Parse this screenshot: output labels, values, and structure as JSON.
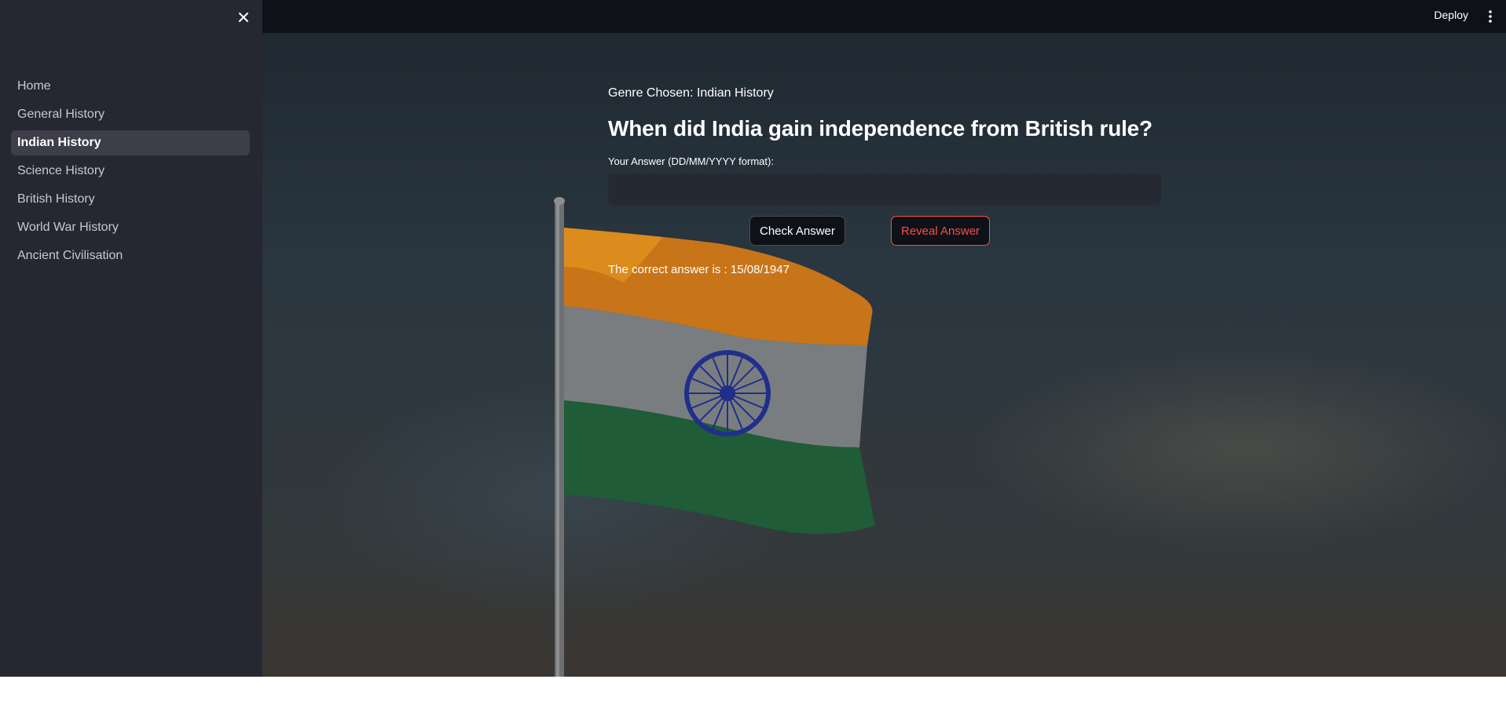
{
  "sidebar": {
    "items": [
      {
        "label": "Home"
      },
      {
        "label": "General History"
      },
      {
        "label": "Indian History"
      },
      {
        "label": "Science History"
      },
      {
        "label": "British History"
      },
      {
        "label": "World War History"
      },
      {
        "label": "Ancient Civilisation"
      }
    ],
    "active_index": 2
  },
  "header": {
    "deploy_label": "Deploy"
  },
  "main": {
    "genre_text": "Genre Chosen: Indian History",
    "question": "When did India gain independence from British rule?",
    "answer_label": "Your Answer (DD/MM/YYYY format):",
    "answer_value": "",
    "check_button": "Check Answer",
    "reveal_button": "Reveal Answer",
    "result_text": "The correct answer is : 15/08/1947"
  },
  "colors": {
    "sidebar_bg": "#262730",
    "header_bg": "#0e1117",
    "accent_red": "#ff4b4b",
    "saffron": "#d9821f",
    "flag_green": "#1f6b3c",
    "chakra_blue": "#1f2f8a"
  },
  "icons": {
    "close": "close-icon",
    "menu": "kebab-menu-icon"
  }
}
